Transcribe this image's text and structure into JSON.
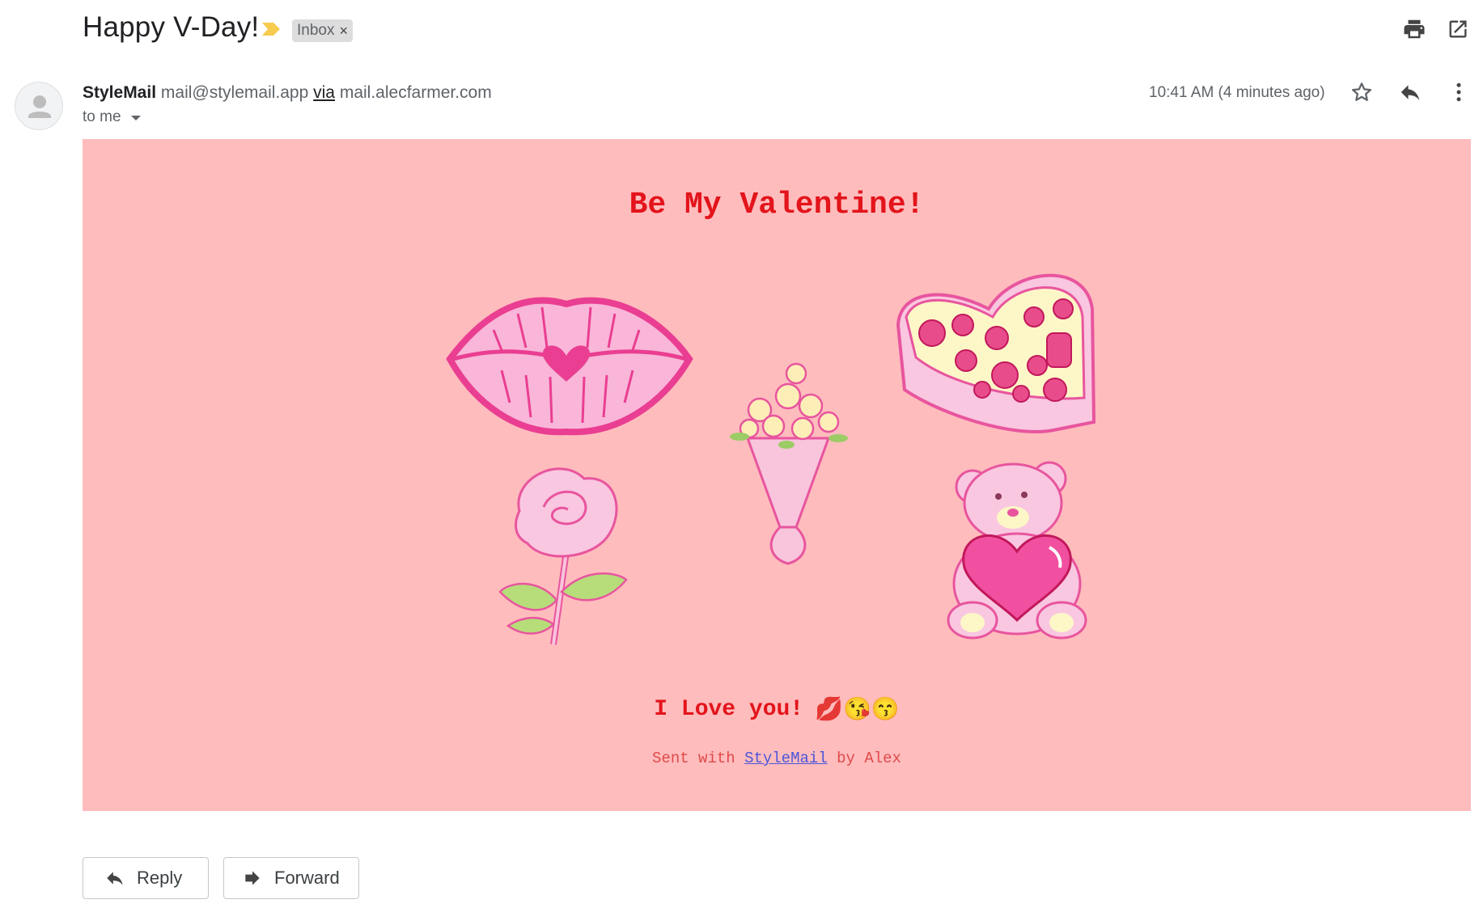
{
  "header": {
    "subject": "Happy V-Day!",
    "label": "Inbox",
    "label_remove": "×",
    "icons": [
      "importance-marker-icon",
      "print-icon",
      "open-in-new-window-icon"
    ]
  },
  "message": {
    "sender_name": "StyleMail",
    "sender_email": "mail@stylemail.app",
    "via": "via",
    "via_domain": "mail.alecfarmer.com",
    "recipient": "to me",
    "timestamp": "10:41 AM (4 minutes ago)",
    "icons": [
      "avatar-icon",
      "star-icon",
      "reply-icon",
      "more-vert-icon"
    ]
  },
  "body": {
    "title": "Be My Valentine!",
    "love_text": "I Love you!",
    "emojis": "💋😘😙",
    "sent_prefix": "Sent with",
    "sent_link": "StyleMail",
    "sent_suffix": "by Alex",
    "background_color": "#ffbcbd",
    "text_color": "#e3141b",
    "illustrations": [
      "lips-illustration",
      "rose-bouquet-illustration",
      "heart-chocolate-box-illustration",
      "pink-rose-illustration",
      "teddy-bear-heart-illustration"
    ]
  },
  "actions": {
    "reply": "Reply",
    "forward": "Forward"
  }
}
